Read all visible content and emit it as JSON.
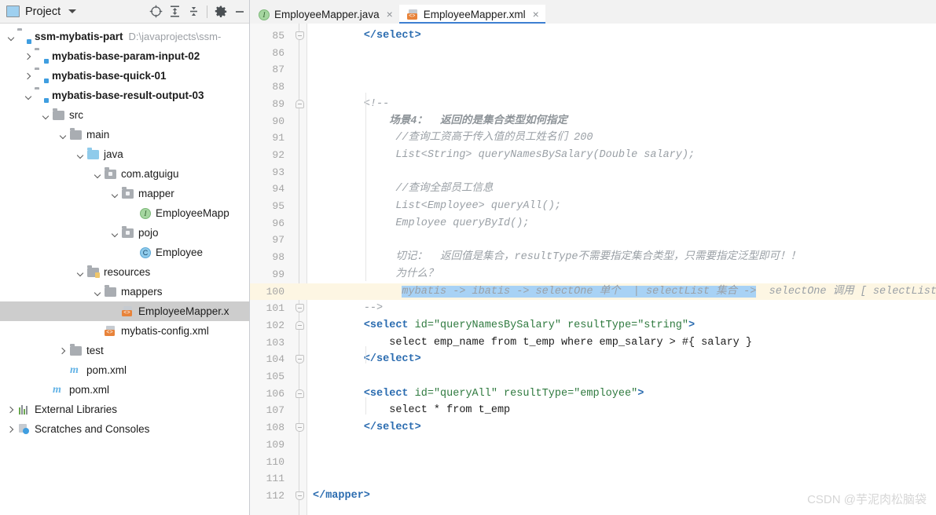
{
  "panel": {
    "title": "Project",
    "icons": {
      "project": "project-icon",
      "dropdown": "chevron-down-icon",
      "locate": "locate-target-icon",
      "expand_all": "expand-all-icon",
      "collapse_all": "collapse-all-icon",
      "settings": "gear-icon",
      "hide": "minimize-icon"
    }
  },
  "tree": [
    {
      "label": "ssm-mybatis-part",
      "path": "D:\\javaprojects\\ssm-",
      "depth": 0,
      "twisty": "down",
      "icon": "module-folder",
      "bold": true,
      "selected": false
    },
    {
      "label": "mybatis-base-param-input-02",
      "path": "",
      "depth": 1,
      "twisty": "right",
      "icon": "module-folder",
      "bold": true,
      "selected": false
    },
    {
      "label": "mybatis-base-quick-01",
      "path": "",
      "depth": 1,
      "twisty": "right",
      "icon": "module-folder",
      "bold": true,
      "selected": false
    },
    {
      "label": "mybatis-base-result-output-03",
      "path": "",
      "depth": 1,
      "twisty": "down",
      "icon": "module-folder",
      "bold": true,
      "selected": false
    },
    {
      "label": "src",
      "path": "",
      "depth": 2,
      "twisty": "down",
      "icon": "folder-gray",
      "bold": false,
      "selected": false
    },
    {
      "label": "main",
      "path": "",
      "depth": 3,
      "twisty": "down",
      "icon": "folder-gray",
      "bold": false,
      "selected": false
    },
    {
      "label": "java",
      "path": "",
      "depth": 4,
      "twisty": "down",
      "icon": "folder-blue",
      "bold": false,
      "selected": false
    },
    {
      "label": "com.atguigu",
      "path": "",
      "depth": 5,
      "twisty": "down",
      "icon": "folder-package",
      "bold": false,
      "selected": false
    },
    {
      "label": "mapper",
      "path": "",
      "depth": 6,
      "twisty": "down",
      "icon": "folder-package",
      "bold": false,
      "selected": false
    },
    {
      "label": "EmployeeMapp",
      "path": "",
      "depth": 7,
      "twisty": "none",
      "icon": "interface-icon",
      "bold": false,
      "selected": false
    },
    {
      "label": "pojo",
      "path": "",
      "depth": 6,
      "twisty": "down",
      "icon": "folder-package",
      "bold": false,
      "selected": false
    },
    {
      "label": "Employee",
      "path": "",
      "depth": 7,
      "twisty": "none",
      "icon": "class-icon",
      "bold": false,
      "selected": false
    },
    {
      "label": "resources",
      "path": "",
      "depth": 4,
      "twisty": "down",
      "icon": "folder-resources",
      "bold": false,
      "selected": false
    },
    {
      "label": "mappers",
      "path": "",
      "depth": 5,
      "twisty": "down",
      "icon": "folder-gray",
      "bold": false,
      "selected": false
    },
    {
      "label": "EmployeeMapper.x",
      "path": "",
      "depth": 6,
      "twisty": "none",
      "icon": "xml-icon",
      "bold": false,
      "selected": true
    },
    {
      "label": "mybatis-config.xml",
      "path": "",
      "depth": 5,
      "twisty": "none",
      "icon": "xml-icon",
      "bold": false,
      "selected": false
    },
    {
      "label": "test",
      "path": "",
      "depth": 3,
      "twisty": "right",
      "icon": "folder-gray",
      "bold": false,
      "selected": false
    },
    {
      "label": "pom.xml",
      "path": "",
      "depth": 3,
      "twisty": "none",
      "icon": "maven-icon",
      "bold": false,
      "selected": false
    },
    {
      "label": "pom.xml",
      "path": "",
      "depth": 2,
      "twisty": "none",
      "icon": "maven-icon",
      "bold": false,
      "selected": false
    },
    {
      "label": "External Libraries",
      "path": "",
      "depth": 0,
      "twisty": "right",
      "icon": "libraries-icon",
      "bold": false,
      "selected": false
    },
    {
      "label": "Scratches and Consoles",
      "path": "",
      "depth": 0,
      "twisty": "right",
      "icon": "scratches-icon",
      "bold": false,
      "selected": false
    }
  ],
  "tabs": [
    {
      "label": "EmployeeMapper.java",
      "icon": "interface-icon",
      "active": false,
      "close": "×"
    },
    {
      "label": "EmployeeMapper.xml",
      "icon": "xml-icon",
      "active": true,
      "close": "×"
    }
  ],
  "editor": {
    "first_line": 85,
    "highlight_line": 100,
    "lines": [
      {
        "n": 85,
        "fold": "end",
        "segs": [
          {
            "t": "        ",
            "c": "plain"
          },
          {
            "t": "</select>",
            "c": "tagname"
          }
        ]
      },
      {
        "n": 86,
        "fold": "",
        "segs": []
      },
      {
        "n": 87,
        "fold": "",
        "segs": []
      },
      {
        "n": 88,
        "fold": "",
        "segs": []
      },
      {
        "n": 89,
        "fold": "start",
        "segs": [
          {
            "t": "        ",
            "c": "plain"
          },
          {
            "t": "<!--",
            "c": "cmt"
          }
        ]
      },
      {
        "n": 90,
        "fold": "",
        "segs": [
          {
            "t": "            ",
            "c": "plain"
          },
          {
            "t": "场景4：  返回的是集合类型如何指定",
            "c": "cmt-m"
          }
        ]
      },
      {
        "n": 91,
        "fold": "",
        "segs": [
          {
            "t": "            ",
            "c": "plain"
          },
          {
            "t": " //查询工资高于传入值的员工姓名们 200",
            "c": "cmt"
          }
        ]
      },
      {
        "n": 92,
        "fold": "",
        "segs": [
          {
            "t": "            ",
            "c": "plain"
          },
          {
            "t": " List<String> queryNamesBySalary(Double salary);",
            "c": "cmt"
          }
        ]
      },
      {
        "n": 93,
        "fold": "",
        "segs": []
      },
      {
        "n": 94,
        "fold": "",
        "segs": [
          {
            "t": "            ",
            "c": "plain"
          },
          {
            "t": " //查询全部员工信息",
            "c": "cmt"
          }
        ]
      },
      {
        "n": 95,
        "fold": "",
        "segs": [
          {
            "t": "            ",
            "c": "plain"
          },
          {
            "t": " List<Employee> queryAll();",
            "c": "cmt"
          }
        ]
      },
      {
        "n": 96,
        "fold": "",
        "segs": [
          {
            "t": "            ",
            "c": "plain"
          },
          {
            "t": " Employee queryById();",
            "c": "cmt"
          }
        ]
      },
      {
        "n": 97,
        "fold": "",
        "segs": []
      },
      {
        "n": 98,
        "fold": "",
        "segs": [
          {
            "t": "            ",
            "c": "plain"
          },
          {
            "t": " 切记：  返回值是集合，resultType不需要指定集合类型，只需要指定泛型即可！！",
            "c": "cmt"
          }
        ]
      },
      {
        "n": 99,
        "fold": "",
        "segs": [
          {
            "t": "            ",
            "c": "plain"
          },
          {
            "t": " 为什么？",
            "c": "cmt"
          }
        ]
      },
      {
        "n": 100,
        "fold": "",
        "segs": [
          {
            "t": "              ",
            "c": "plain"
          },
          {
            "t": "mybatis -> ibatis -> selectOne 单个  | selectList 集合 ->",
            "c": "cmt sel"
          },
          {
            "t": "  selectOne 调用 [ selectList ]",
            "c": "cmt"
          }
        ]
      },
      {
        "n": 101,
        "fold": "end",
        "segs": [
          {
            "t": "        ",
            "c": "plain"
          },
          {
            "t": "-->",
            "c": "cmt"
          }
        ]
      },
      {
        "n": 102,
        "fold": "start",
        "segs": [
          {
            "t": "        ",
            "c": "plain"
          },
          {
            "t": "<select",
            "c": "tagname"
          },
          {
            "t": " id=",
            "c": "attr"
          },
          {
            "t": "\"queryNamesBySalary\"",
            "c": "attrval"
          },
          {
            "t": " resultType=",
            "c": "attr"
          },
          {
            "t": "\"string\"",
            "c": "attrval"
          },
          {
            "t": ">",
            "c": "tagname"
          }
        ]
      },
      {
        "n": 103,
        "fold": "",
        "segs": [
          {
            "t": "            select emp_name from t_emp where emp_salary > #{ salary }",
            "c": "plain"
          }
        ]
      },
      {
        "n": 104,
        "fold": "end",
        "segs": [
          {
            "t": "        ",
            "c": "plain"
          },
          {
            "t": "</select>",
            "c": "tagname"
          }
        ]
      },
      {
        "n": 105,
        "fold": "",
        "segs": []
      },
      {
        "n": 106,
        "fold": "start",
        "segs": [
          {
            "t": "        ",
            "c": "plain"
          },
          {
            "t": "<select",
            "c": "tagname"
          },
          {
            "t": " id=",
            "c": "attr"
          },
          {
            "t": "\"queryAll\"",
            "c": "attrval"
          },
          {
            "t": " resultType=",
            "c": "attr"
          },
          {
            "t": "\"employee\"",
            "c": "attrval"
          },
          {
            "t": ">",
            "c": "tagname"
          }
        ]
      },
      {
        "n": 107,
        "fold": "",
        "segs": [
          {
            "t": "            select * from t_emp",
            "c": "plain"
          }
        ]
      },
      {
        "n": 108,
        "fold": "end",
        "segs": [
          {
            "t": "        ",
            "c": "plain"
          },
          {
            "t": "</select>",
            "c": "tagname"
          }
        ]
      },
      {
        "n": 109,
        "fold": "",
        "segs": []
      },
      {
        "n": 110,
        "fold": "",
        "segs": []
      },
      {
        "n": 111,
        "fold": "",
        "segs": []
      },
      {
        "n": 112,
        "fold": "end",
        "segs": [
          {
            "t": "</mapper>",
            "c": "tagname"
          }
        ]
      }
    ]
  },
  "watermark": "CSDN @芋泥肉松脑袋",
  "colors": {
    "accent": "#3d7fd1",
    "selection": "#a8d2f5",
    "line_highlight": "#fdf6e3",
    "tree_selected": "#cdcdcd",
    "comment": "#9aa0a6",
    "tag": "#2b6cb0",
    "attr": "#2f7a3f"
  }
}
